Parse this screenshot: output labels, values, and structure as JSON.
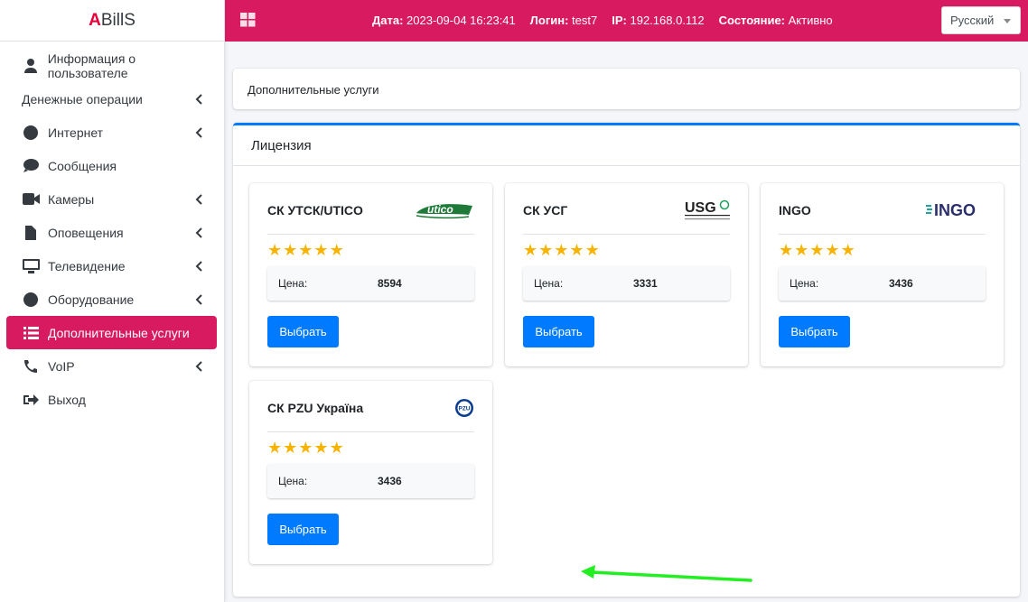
{
  "brand": {
    "accent": "A",
    "rest": "BillS"
  },
  "sidebar": {
    "items": [
      {
        "label": "Информация о пользователе"
      },
      {
        "label": "Денежные операции"
      },
      {
        "label": "Интернет"
      },
      {
        "label": "Сообщения"
      },
      {
        "label": "Камеры"
      },
      {
        "label": "Оповещения"
      },
      {
        "label": "Телевидение"
      },
      {
        "label": "Оборудование"
      },
      {
        "label": "Дополнительные услуги"
      },
      {
        "label": "VoIP"
      },
      {
        "label": "Выход"
      }
    ]
  },
  "header": {
    "date_label": "Дата:",
    "date_value": "2023-09-04 16:23:41",
    "login_label": "Логин:",
    "login_value": "test7",
    "ip_label": "IP:",
    "ip_value": "192.168.0.112",
    "status_label": "Состояние:",
    "status_value": "Активно",
    "language": "Русский"
  },
  "breadcrumb": "Дополнительные услуги",
  "panel_title": "Лицензия",
  "cards": [
    {
      "title": "СК УТСК/UTICO",
      "logo_text": "utico",
      "price_label": "Цена:",
      "price": "8594",
      "button": "Выбрать",
      "rating": 5
    },
    {
      "title": "СК УСГ",
      "logo_text": "USG",
      "price_label": "Цена:",
      "price": "3331",
      "button": "Выбрать",
      "rating": 5
    },
    {
      "title": "INGO",
      "logo_text": "INGO",
      "price_label": "Цена:",
      "price": "3436",
      "button": "Выбрать",
      "rating": 5
    },
    {
      "title": "СК PZU Україна",
      "logo_text": "PZU",
      "price_label": "Цена:",
      "price": "3436",
      "button": "Выбрать",
      "rating": 5
    }
  ],
  "colors": {
    "header": "#d81b60",
    "active_nav": "#d81b60",
    "primary": "#007bff",
    "star": "#f6b300",
    "arrow": "#22ee22"
  }
}
